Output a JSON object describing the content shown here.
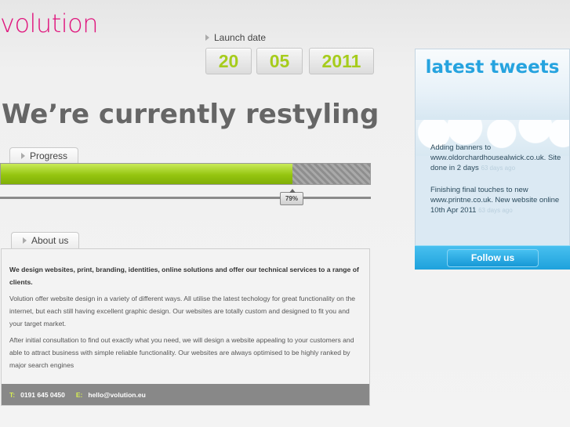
{
  "brand": {
    "logo": "volution",
    "accent": "#e0157d"
  },
  "launch": {
    "label": "Launch date",
    "day": "20",
    "month": "05",
    "year": "2011"
  },
  "headline": "We’re currently restyling",
  "progress": {
    "tab_label": "Progress",
    "value_percent": 79,
    "badge": "79%"
  },
  "about": {
    "tab_label": "About us",
    "lead": "We design websites, print, branding, identities, online solutions and offer our technical services to a range of clients.",
    "para1": "Volution offer website design in a variety of different ways. All utilise the latest techology for great functionality on the internet, but each still having excellent graphic design. Our websites are totally custom and designed to fit you and your target market.",
    "para2": "After initial consultation to find out exactly what you need, we will design a website appealing to your customers and able to attract business with simple reliable functionality. Our websites are always optimised to be highly ranked by major search engines"
  },
  "contact": {
    "t_label": "T:",
    "phone": "0191 645 0450",
    "e_label": "E:",
    "email": "hello@volution.eu"
  },
  "twitter": {
    "title": "latest tweets",
    "tweets": [
      {
        "text": "Adding banners to www.oldorchardhousealwick.co.uk. Site done in 2 days",
        "ago": "63 days ago"
      },
      {
        "text": "Finishing final touches to new www.printne.co.uk. New website online 10th Apr 2011",
        "ago": "63 days ago"
      }
    ],
    "follow_label": "Follow us"
  },
  "colors": {
    "green": "#95c510",
    "blue": "#1ea2dc"
  }
}
